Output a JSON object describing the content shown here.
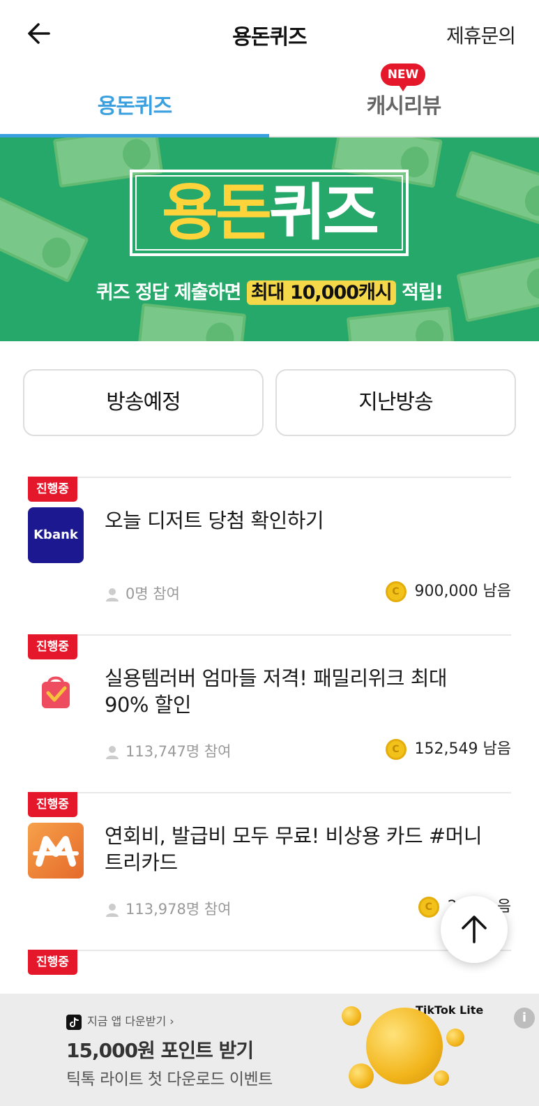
{
  "header": {
    "title": "용돈퀴즈",
    "partner_link": "제휴문의"
  },
  "tabs": [
    {
      "label": "용돈퀴즈",
      "active": true
    },
    {
      "label": "캐시리뷰",
      "active": false,
      "badge": "NEW"
    }
  ],
  "banner": {
    "title_part1": "용돈",
    "title_part2": "퀴즈",
    "subtitle_prefix": "퀴즈 정답 제출하면 ",
    "subtitle_highlight": "최대 10,000캐시",
    "subtitle_suffix": " 적립!"
  },
  "filters": {
    "upcoming": "방송예정",
    "past": "지난방송"
  },
  "quizzes": [
    {
      "status": "진행중",
      "thumb_label": "Kbank",
      "title": "오늘 디저트 당첨 확인하기",
      "participants": "0명 참여",
      "coin_glyph": "C",
      "remaining": "900,000 남음"
    },
    {
      "status": "진행중",
      "title": "실용템러버 엄마들 저격! 패밀리위크 최대 90% 할인",
      "participants": "113,747명 참여",
      "coin_glyph": "C",
      "remaining": "152,549 남음"
    },
    {
      "status": "진행중",
      "title": "연회비, 발급비 모두 무료! 비상용 카드 #머니트리카드",
      "participants": "113,978명 참여",
      "coin_glyph": "C",
      "remaining": "251,…음"
    },
    {
      "status": "진행중"
    }
  ],
  "ad": {
    "app_line": "지금 앱 다운받기 ›",
    "title": "15,000원 포인트 받기",
    "description": "틱톡 라이트 첫 다운로드 이벤트",
    "brand": "TikTok Lite",
    "info_glyph": "i"
  },
  "colors": {
    "accent_blue": "#3ba0df",
    "badge_red": "#e5172a",
    "banner_green": "#27a86b",
    "banner_yellow": "#ffd43b",
    "coin_gold": "#f2c21b"
  },
  "icons": [
    "back-arrow-icon",
    "person-icon",
    "coin-icon",
    "arrow-up-icon",
    "tiktok-icon",
    "info-icon"
  ]
}
